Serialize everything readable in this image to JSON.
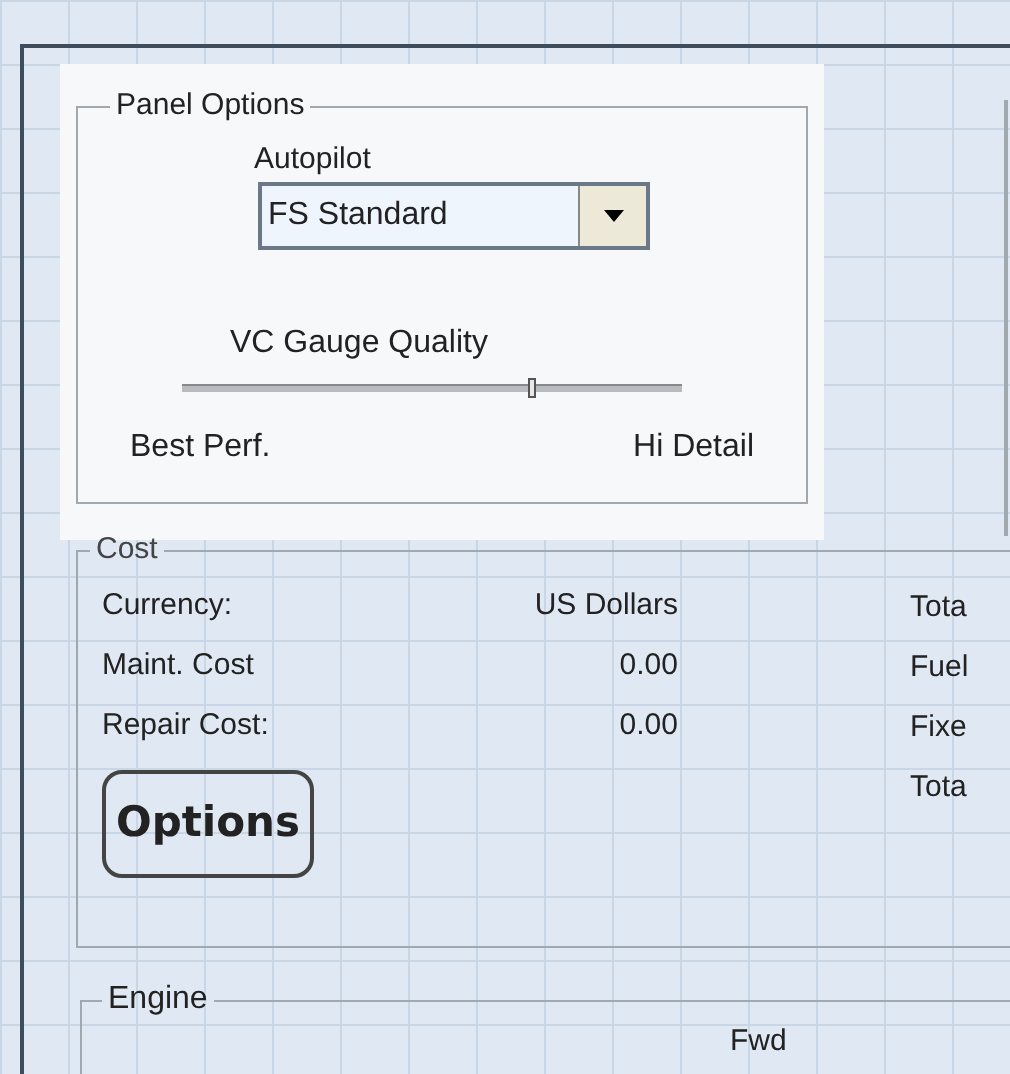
{
  "panel_options": {
    "title": "Panel Options",
    "autopilot": {
      "label": "Autopilot",
      "value": "FS Standard"
    },
    "vc_gauge_quality": {
      "label": "VC Gauge Quality",
      "level": 0.7,
      "min_label": "Best Perf.",
      "max_label": "Hi Detail"
    }
  },
  "cost": {
    "title": "Cost",
    "rows": [
      {
        "label": "Currency:",
        "value": "US Dollars"
      },
      {
        "label": "Maint. Cost",
        "value": "0.00"
      },
      {
        "label": "Repair Cost:",
        "value": "0.00"
      }
    ],
    "right_labels": [
      "Tota",
      "Fuel",
      "Fixe",
      "Tota"
    ],
    "button": "Options"
  },
  "engine": {
    "title": "Engine",
    "column_1": "Fwd"
  }
}
